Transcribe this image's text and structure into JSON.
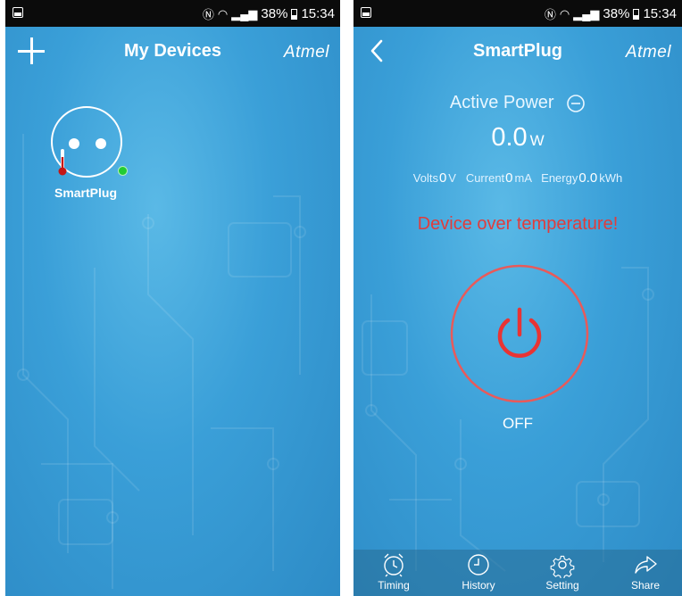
{
  "status_bar": {
    "battery_percent": "38%",
    "time": "15:34"
  },
  "left_screen": {
    "title": "My Devices",
    "brand": "Atmel",
    "devices": [
      {
        "name": "SmartPlug",
        "online": true
      }
    ]
  },
  "right_screen": {
    "title": "SmartPlug",
    "brand": "Atmel",
    "active_power_label": "Active Power",
    "power_value": "0.0",
    "power_unit": "W",
    "metrics": {
      "volts_label": "Volts",
      "volts_value": "0",
      "volts_unit": "V",
      "current_label": "Current",
      "current_value": "0",
      "current_unit": "mA",
      "energy_label": "Energy",
      "energy_value": "0.0",
      "energy_unit": "kWh"
    },
    "warning": "Device over temperature!",
    "state": "OFF",
    "tabs": [
      {
        "label": "Timing",
        "icon": "alarm-clock-icon"
      },
      {
        "label": "History",
        "icon": "clock-icon"
      },
      {
        "label": "Setting",
        "icon": "gear-icon"
      },
      {
        "label": "Share",
        "icon": "share-icon"
      }
    ]
  },
  "colors": {
    "background": "#3a9fd8",
    "warning": "#e03c3c",
    "power_ring": "#e85a5a",
    "online": "#22cc33"
  }
}
